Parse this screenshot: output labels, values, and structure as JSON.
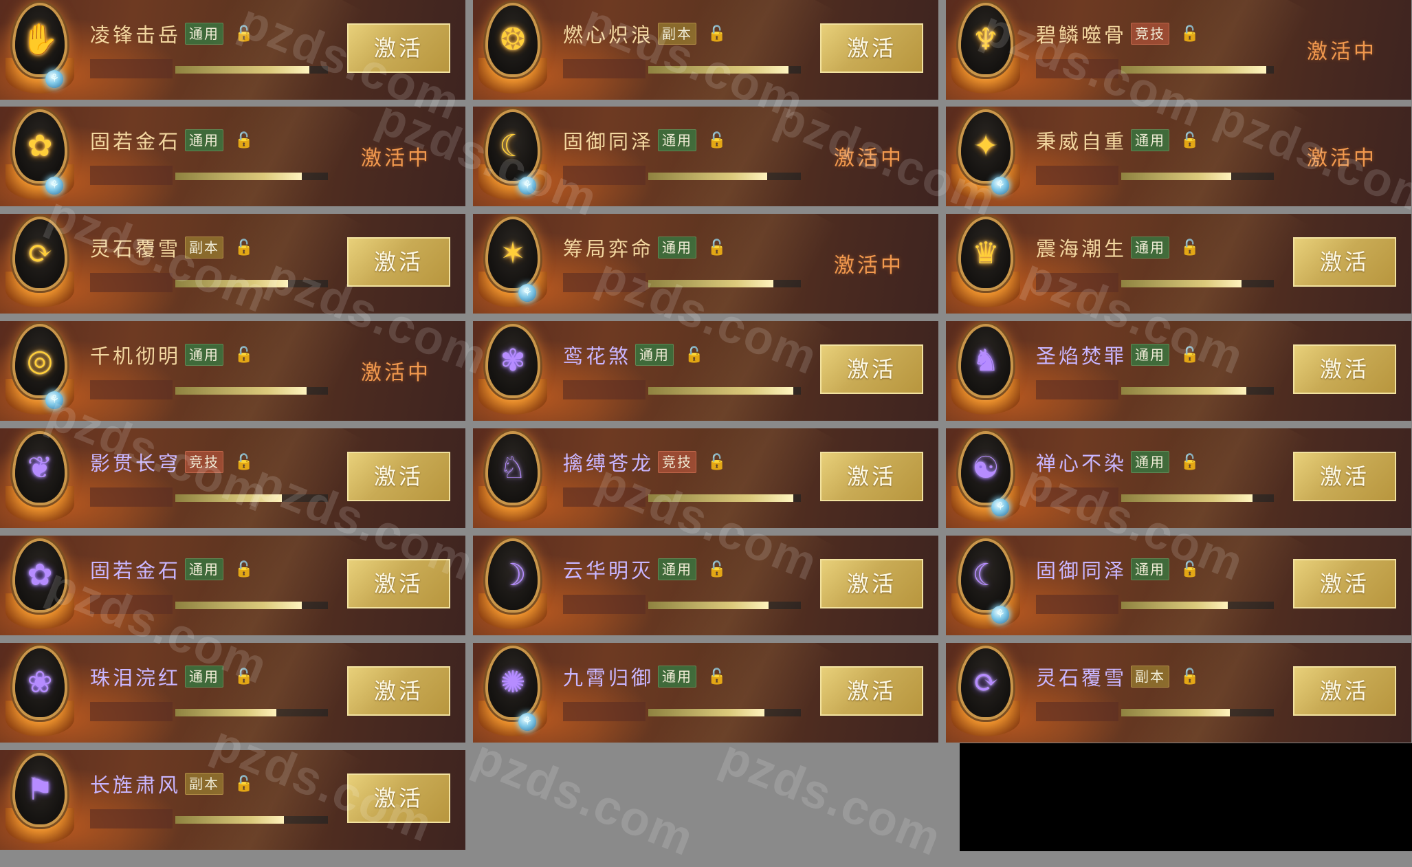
{
  "cards": [
    {
      "name": "凌锋击岳",
      "tag": "通用",
      "tag_color": "green",
      "state": "button",
      "btn": "激活",
      "theme": "gold",
      "glyph": "✋",
      "gem": true,
      "progress": 0.88
    },
    {
      "name": "燃心炽浪",
      "tag": "副本",
      "tag_color": "gold",
      "state": "button",
      "btn": "激活",
      "theme": "gold",
      "glyph": "❂",
      "gem": false,
      "progress": 0.92
    },
    {
      "name": "碧鳞噬骨",
      "tag": "竞技",
      "tag_color": "red",
      "state": "active",
      "active": "激活中",
      "theme": "gold",
      "glyph": "♆",
      "gem": false,
      "progress": 0.95
    },
    {
      "name": "固若金石",
      "tag": "通用",
      "tag_color": "green",
      "state": "active",
      "active": "激活中",
      "theme": "gold",
      "glyph": "✿",
      "gem": true,
      "progress": 0.83
    },
    {
      "name": "固御同泽",
      "tag": "通用",
      "tag_color": "green",
      "state": "active",
      "active": "激活中",
      "theme": "gold",
      "glyph": "☾",
      "gem": true,
      "progress": 0.78
    },
    {
      "name": "秉威自重",
      "tag": "通用",
      "tag_color": "green",
      "state": "active",
      "active": "激活中",
      "theme": "gold",
      "glyph": "✦",
      "gem": true,
      "progress": 0.72
    },
    {
      "name": "灵石覆雪",
      "tag": "副本",
      "tag_color": "gold",
      "state": "button",
      "btn": "激活",
      "theme": "gold",
      "glyph": "⟳",
      "gem": false,
      "progress": 0.74
    },
    {
      "name": "筹局弈命",
      "tag": "通用",
      "tag_color": "green",
      "state": "active",
      "active": "激活中",
      "theme": "gold",
      "glyph": "✶",
      "gem": true,
      "progress": 0.82
    },
    {
      "name": "震海潮生",
      "tag": "通用",
      "tag_color": "green",
      "state": "button",
      "btn": "激活",
      "theme": "gold",
      "glyph": "♛",
      "gem": false,
      "progress": 0.79
    },
    {
      "name": "千机彻明",
      "tag": "通用",
      "tag_color": "green",
      "state": "active",
      "active": "激活中",
      "theme": "gold",
      "glyph": "◎",
      "gem": true,
      "progress": 0.86
    },
    {
      "name": "鸾花煞",
      "tag": "通用",
      "tag_color": "green",
      "state": "button",
      "btn": "激活",
      "theme": "purple",
      "glyph": "✾",
      "gem": false,
      "progress": 0.95
    },
    {
      "name": "圣焰焚罪",
      "tag": "通用",
      "tag_color": "green",
      "state": "button",
      "btn": "激活",
      "theme": "purple",
      "glyph": "♞",
      "gem": false,
      "progress": 0.82
    },
    {
      "name": "影贯长穹",
      "tag": "竞技",
      "tag_color": "red",
      "state": "button",
      "btn": "激活",
      "theme": "purple",
      "glyph": "❦",
      "gem": false,
      "progress": 0.7
    },
    {
      "name": "擒缚苍龙",
      "tag": "竞技",
      "tag_color": "red",
      "state": "button",
      "btn": "激活",
      "theme": "purple",
      "glyph": "♘",
      "gem": false,
      "progress": 0.95
    },
    {
      "name": "禅心不染",
      "tag": "通用",
      "tag_color": "green",
      "state": "button",
      "btn": "激活",
      "theme": "purple",
      "glyph": "☯",
      "gem": true,
      "progress": 0.86
    },
    {
      "name": "固若金石",
      "tag": "通用",
      "tag_color": "green",
      "state": "button",
      "btn": "激活",
      "theme": "purple",
      "glyph": "✿",
      "gem": false,
      "progress": 0.83
    },
    {
      "name": "云华明灭",
      "tag": "通用",
      "tag_color": "green",
      "state": "button",
      "btn": "激活",
      "theme": "purple",
      "glyph": "☽",
      "gem": false,
      "progress": 0.79
    },
    {
      "name": "固御同泽",
      "tag": "通用",
      "tag_color": "green",
      "state": "button",
      "btn": "激活",
      "theme": "purple",
      "glyph": "☾",
      "gem": true,
      "progress": 0.7
    },
    {
      "name": "珠泪浣红",
      "tag": "通用",
      "tag_color": "green",
      "state": "button",
      "btn": "激活",
      "theme": "purple",
      "glyph": "❀",
      "gem": false,
      "progress": 0.66
    },
    {
      "name": "九霄归御",
      "tag": "通用",
      "tag_color": "green",
      "state": "button",
      "btn": "激活",
      "theme": "purple",
      "glyph": "✺",
      "gem": true,
      "progress": 0.76
    },
    {
      "name": "灵石覆雪",
      "tag": "副本",
      "tag_color": "gold",
      "state": "button",
      "btn": "激活",
      "theme": "purple",
      "glyph": "⟳",
      "gem": false,
      "progress": 0.71
    },
    {
      "name": "长旌肃风",
      "tag": "副本",
      "tag_color": "gold",
      "state": "button",
      "btn": "激活",
      "theme": "purple",
      "glyph": "⚑",
      "gem": false,
      "progress": 0.71
    }
  ],
  "watermark": "pzds.com"
}
